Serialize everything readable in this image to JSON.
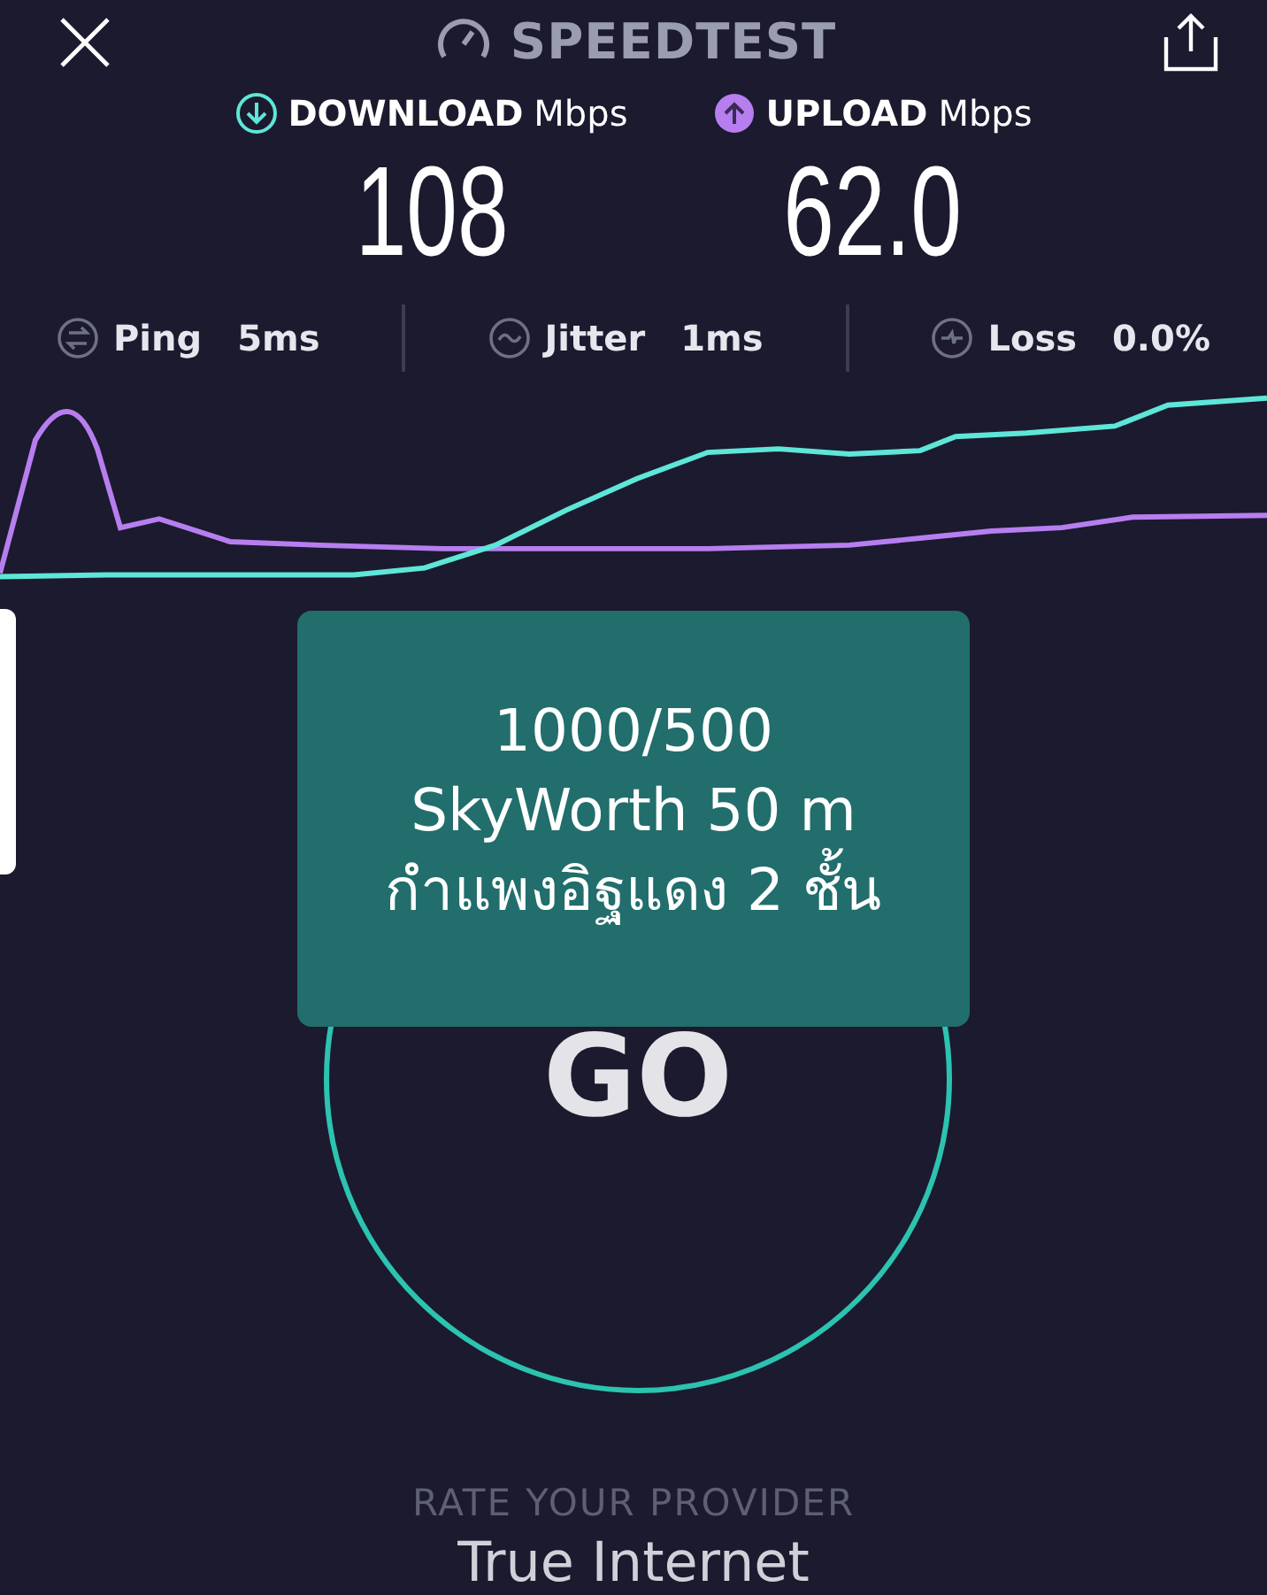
{
  "header": {
    "title": "SPEEDTEST"
  },
  "results": [
    {
      "kind": "download",
      "label": "DOWNLOAD",
      "unit": "Mbps",
      "value": "108",
      "color": "#5ee6d8"
    },
    {
      "kind": "upload",
      "label": "UPLOAD",
      "unit": "Mbps",
      "value": "62.0",
      "color": "#b77ef0"
    }
  ],
  "stats": [
    {
      "kind": "ping",
      "label": "Ping",
      "value": "5ms"
    },
    {
      "kind": "jitter",
      "label": "Jitter",
      "value": "1ms"
    },
    {
      "kind": "loss",
      "label": "Loss",
      "value": "0.0%"
    }
  ],
  "go_button": {
    "label": "GO"
  },
  "note": {
    "lines": [
      "1000/500",
      "SkyWorth 50 m",
      "กำแพงอิฐแดง 2 ชั้น"
    ]
  },
  "provider": {
    "prompt": "RATE YOUR PROVIDER",
    "name": "True Internet"
  }
}
